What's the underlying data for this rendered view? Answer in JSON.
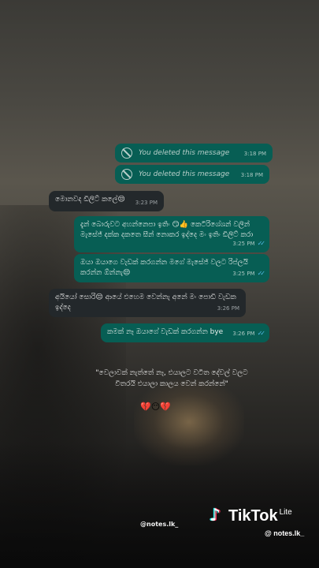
{
  "messages": [
    {
      "side": "out",
      "deleted": true,
      "text": "You deleted this message",
      "time": "3:18 PM"
    },
    {
      "side": "out",
      "deleted": true,
      "text": "You deleted this message",
      "time": "3:18 PM"
    },
    {
      "side": "in",
      "text": "මොනවද ඩිලිට් කලේ😒",
      "time": "3:23 PM"
    },
    {
      "side": "out",
      "text": "දැන් බොරුවට අහන්නෙපා ඉතිං 😏👍  කෙටිරිශේශන් වලින් මැසේජ් දක්ක දකතෙ සීන් නොකර ඉද්දෙ මං ඉතිං ඩිලිට් කරා",
      "time": "3:25 PM",
      "ticks": "✓✓"
    },
    {
      "side": "out",
      "text": "ඔයා ඔයාගෙ වැඩක් කරගන්න මගේ මැසේජ් වලට රිප්ලයි කරන්න ඕන්නැ😒",
      "time": "3:25 PM",
      "ticks": "✓✓"
    },
    {
      "side": "in",
      "text": "අයියෝ සොරි😔 ආයේ එහෙම වෙන්නැ අනේ මං පොඩි වැඩක ඉද්දෙ",
      "time": "3:26 PM"
    },
    {
      "side": "out",
      "text": "කමක් නෑ ඔයාගේ වැඩක් කරගන්න bye",
      "time": "3:26 PM",
      "ticks": "✓✓"
    }
  ],
  "quote": "\"වෙලාවක් නැත්තේ නෑ, එයාලට වටිත දේවල් වලට විතරයි එයාලා කාලය වෙන් කරන්නේ\"",
  "quote_emojis": "💔😶💔",
  "handle": "@notes.lk_",
  "tiktok": {
    "brand": "TikTok",
    "lite": "Lite",
    "handle": "@ notes.lk_"
  },
  "colors": {
    "outgoing_bubble": "#075e54",
    "incoming_bubble": "#23282b",
    "read_ticks": "#53bdeb"
  },
  "icons": {
    "deleted": "no-entry-icon",
    "logo": "tiktok-note-icon"
  }
}
